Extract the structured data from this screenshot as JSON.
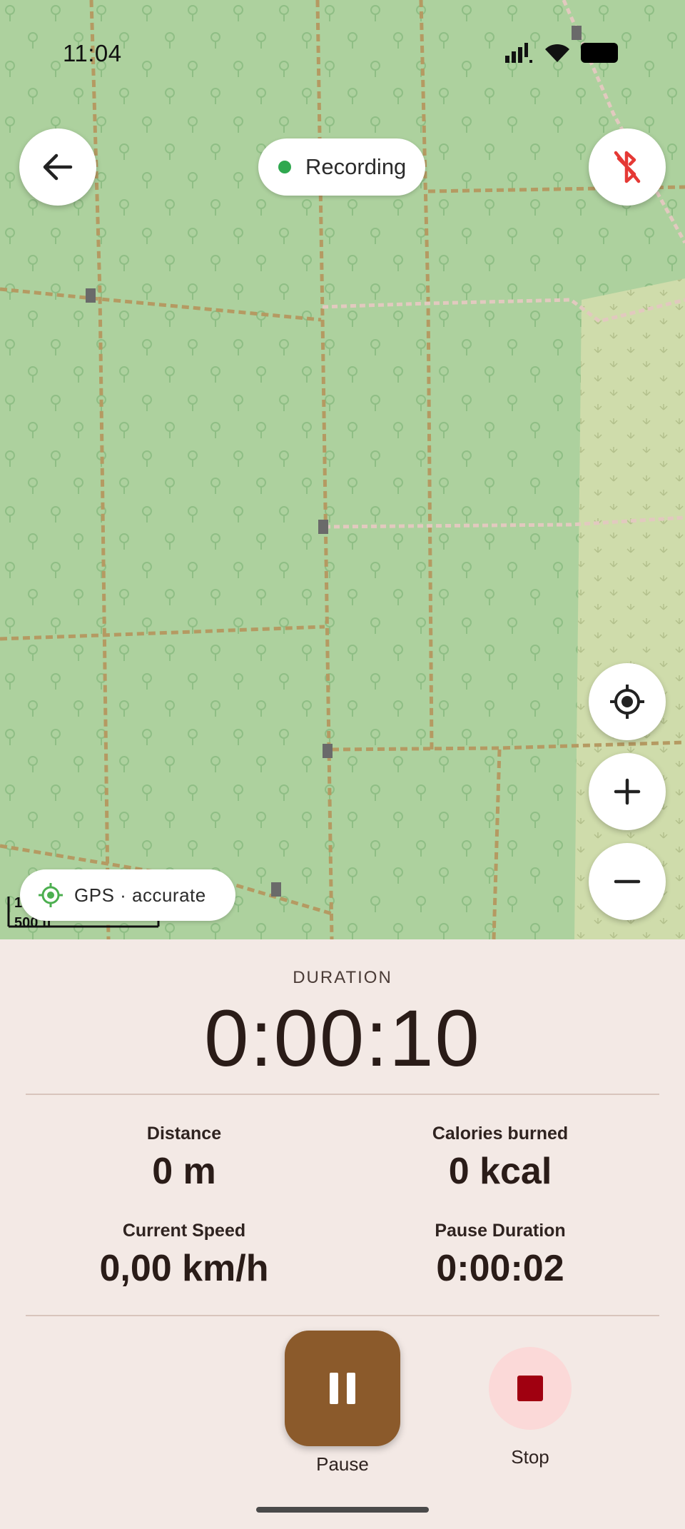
{
  "status_bar": {
    "time": "11:04"
  },
  "map": {
    "recording_chip": {
      "label": "Recording",
      "dot_color": "#2fa84f"
    },
    "gps_chip": {
      "label": "GPS · accurate"
    },
    "scale_label": "500 ft",
    "scale_prefix": "1",
    "buttons": {
      "back": "arrow-left-icon",
      "bluetooth": "bluetooth-off-icon",
      "locate": "my-location-icon",
      "zoom_in": "plus-icon",
      "zoom_out": "minus-icon"
    }
  },
  "stats": {
    "duration_label": "DURATION",
    "duration_value": "0:00:10",
    "distance": {
      "label": "Distance",
      "value": "0 m"
    },
    "calories": {
      "label": "Calories burned",
      "value": "0 kcal"
    },
    "speed": {
      "label": "Current Speed",
      "value": "0,00 km/h"
    },
    "pause_duration": {
      "label": "Pause Duration",
      "value": "0:00:02"
    }
  },
  "controls": {
    "pause": {
      "label": "Pause",
      "color": "#8b5a2b"
    },
    "stop": {
      "label": "Stop",
      "color": "#a00010"
    }
  }
}
